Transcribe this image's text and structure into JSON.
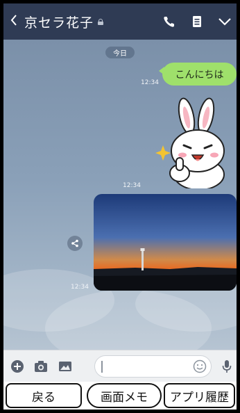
{
  "header": {
    "title": "京セラ花子",
    "back_icon": "chevron-left-icon",
    "icons": [
      "lock-icon",
      "phone-icon",
      "menu-icon",
      "chevron-down-icon"
    ]
  },
  "chat": {
    "date_label": "今日",
    "messages": [
      {
        "type": "text",
        "text": "こんにちは",
        "time": "12:34"
      },
      {
        "type": "sticker",
        "time": "12:34"
      },
      {
        "type": "image",
        "time": "12:34"
      }
    ]
  },
  "input_bar": {
    "icons": [
      "add-icon",
      "camera-icon",
      "image-icon",
      "emoji-icon",
      "microphone-icon"
    ]
  },
  "nav": {
    "back_label": "戻る",
    "memo_label": "画面メモ",
    "history_label": "アプリ履歴"
  },
  "colors": {
    "header_bg": "#2f3b54",
    "bubble_bg": "#9fe06b",
    "chat_bg": "#7a90a8"
  }
}
